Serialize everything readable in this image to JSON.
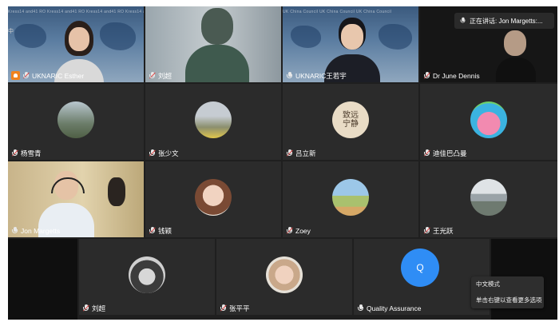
{
  "speaking": {
    "label": "正在讲话: Jon Margetts:..."
  },
  "side_label": "中",
  "row1": [
    {
      "name": "UKNARIC Esther",
      "host": true,
      "mic": "muted",
      "map_text": "Kress14 and41 RO Kress14 and41 RO Kress14 and41 RO Kress14 and41 RO"
    },
    {
      "name": "刘超",
      "mic": "muted"
    },
    {
      "name": "UKNARIC王若宇",
      "mic": "on",
      "map_text": "UK China Council  UK China Council  UK China Council"
    },
    {
      "name": "Dr June Dennis",
      "mic": "muted"
    }
  ],
  "row2": [
    {
      "name": "杨雪青",
      "mic": "muted"
    },
    {
      "name": "张少文",
      "mic": "muted"
    },
    {
      "name": "吕立新",
      "mic": "muted",
      "avatar_text": "致远 宁静"
    },
    {
      "name": "迪佳巴凸曼",
      "mic": "muted"
    }
  ],
  "row3": [
    {
      "name": "Jon Margetts",
      "mic": "on"
    },
    {
      "name": "钱颖",
      "mic": "muted"
    },
    {
      "name": "Zoey",
      "mic": "muted"
    },
    {
      "name": "王光跃",
      "mic": "muted"
    }
  ],
  "row4": [
    {
      "name": "刘超",
      "mic": "muted"
    },
    {
      "name": "张平平",
      "mic": "muted"
    },
    {
      "name": "Quality Assurance",
      "mic": "on",
      "initial": "Q"
    }
  ],
  "context_menu": {
    "items": [
      "中文模式",
      "单击右键以查看更多选项"
    ]
  }
}
